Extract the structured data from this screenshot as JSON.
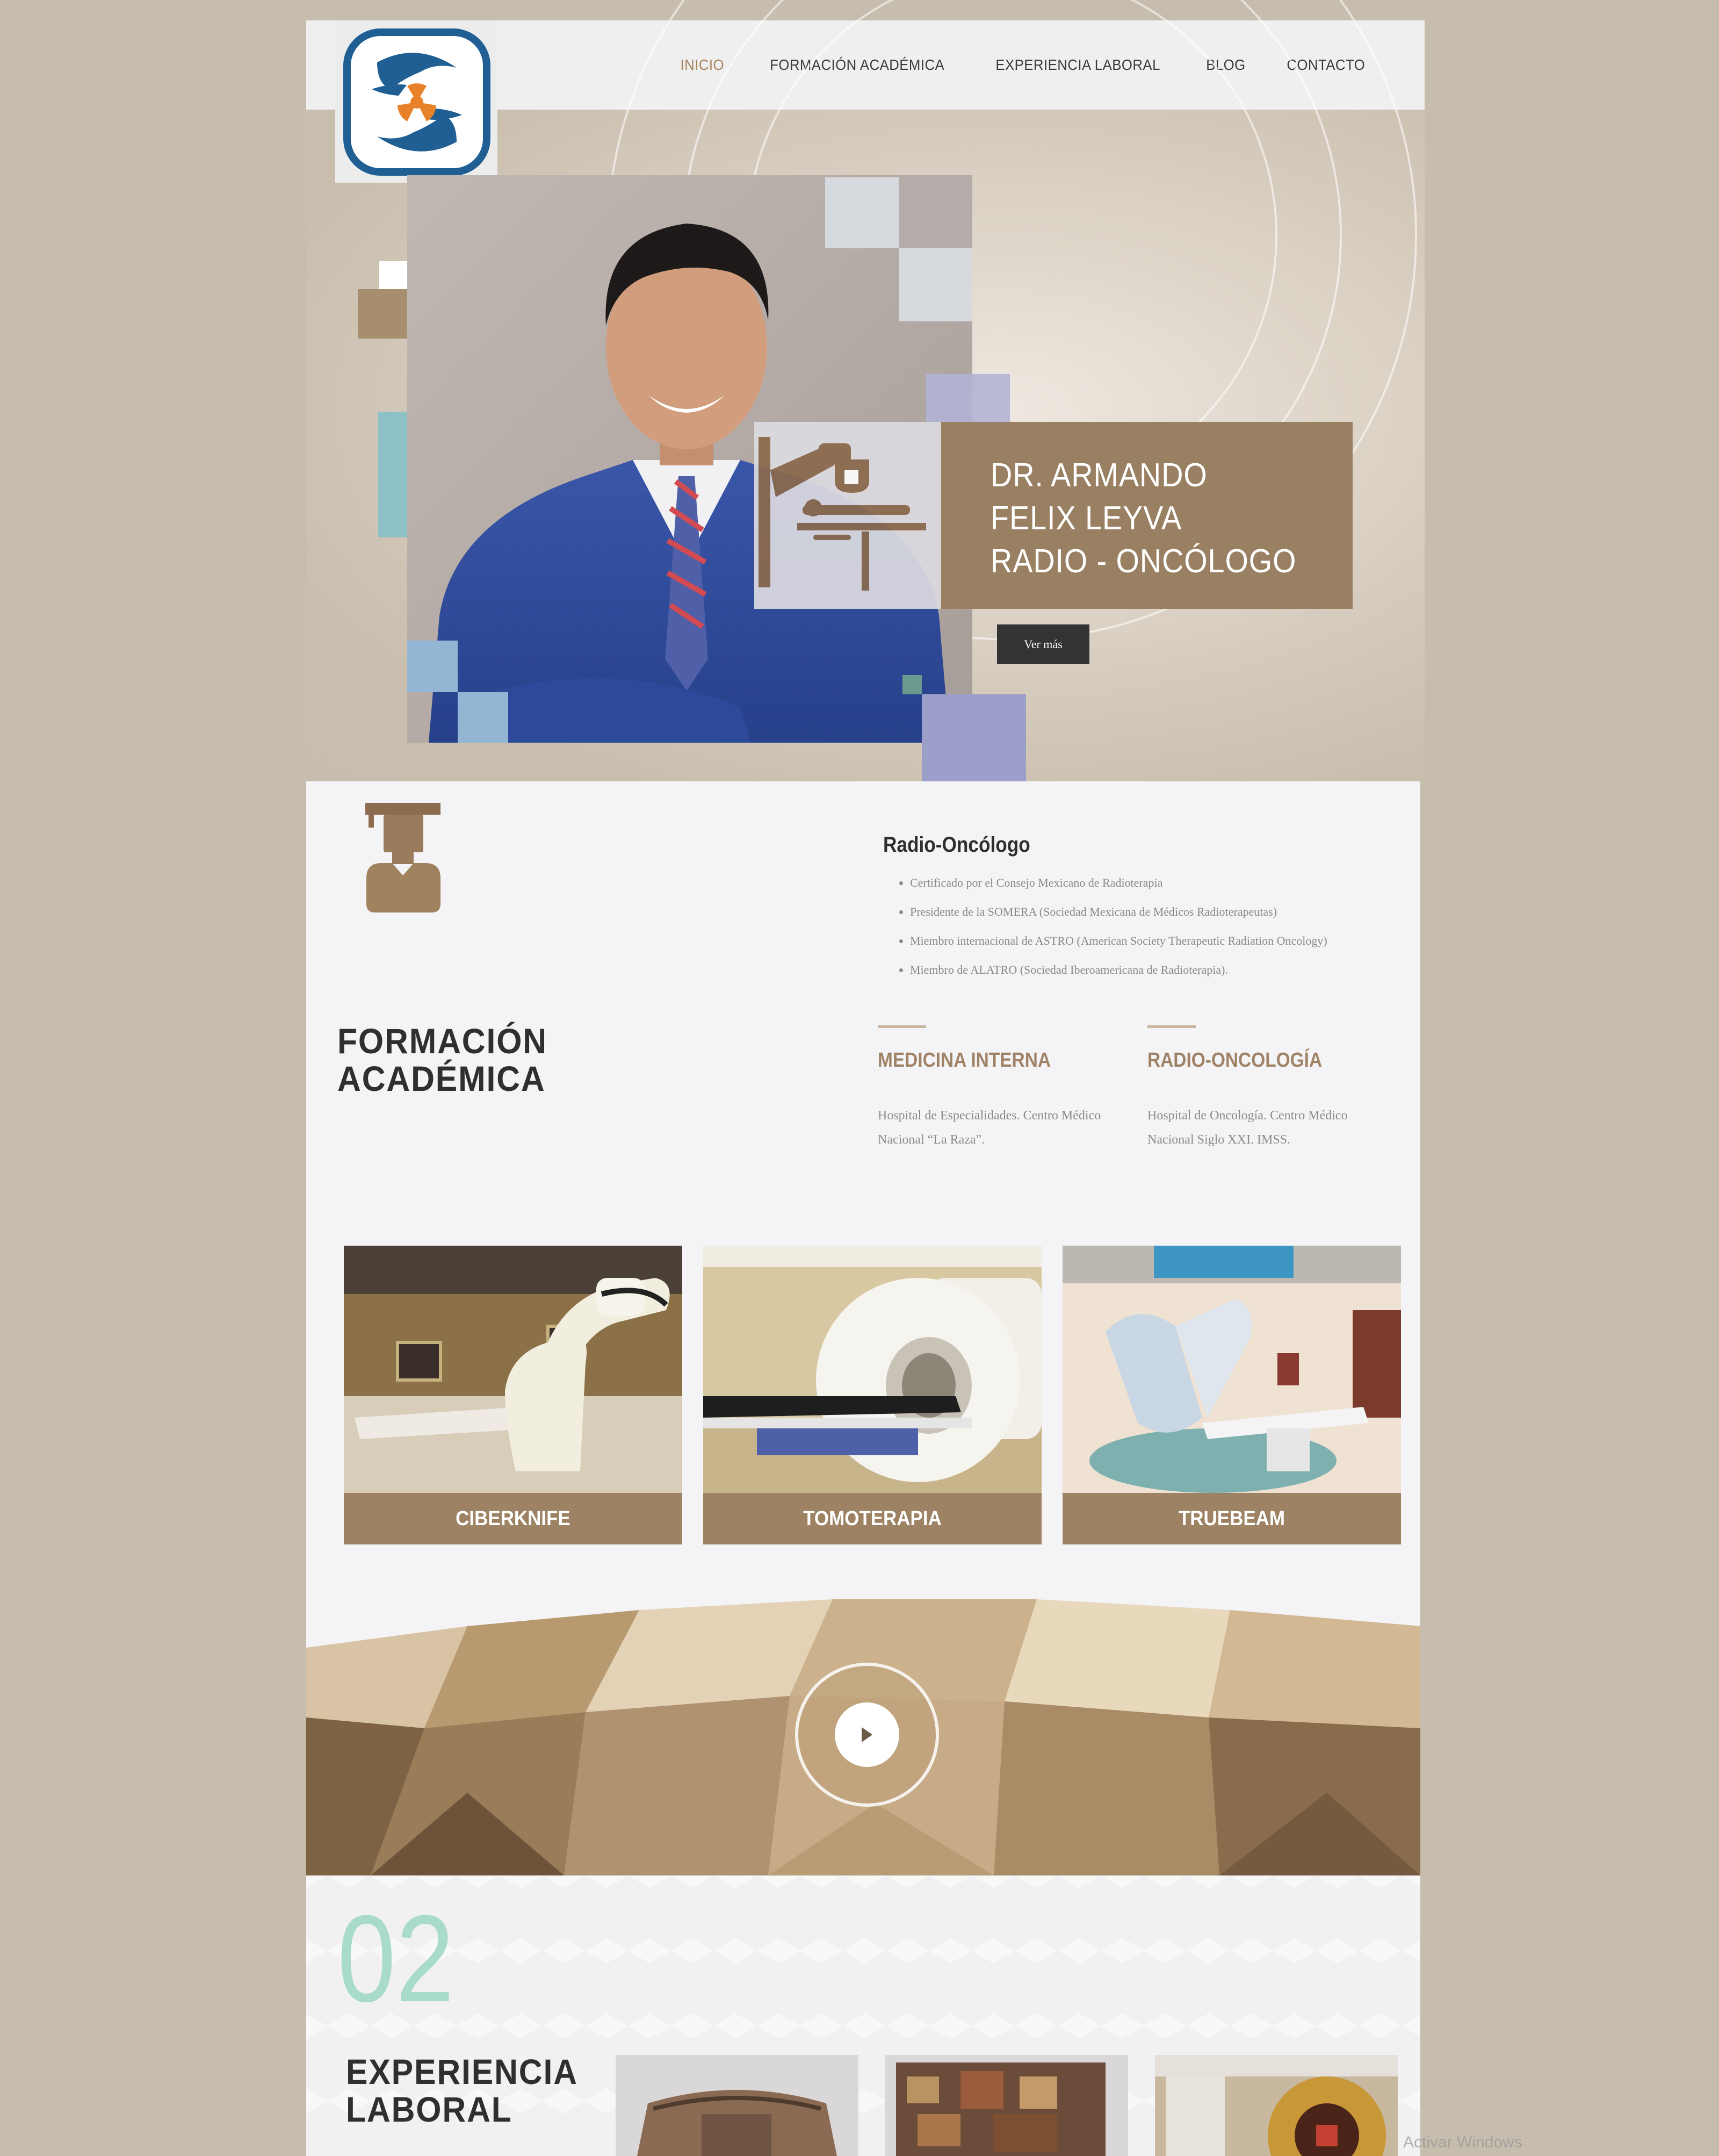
{
  "header": {
    "nav": [
      "INICIO",
      "FORMACIÓN ACADÉMICA",
      "EXPERIENCIA LABORAL",
      "BLOG",
      "CONTACTO"
    ],
    "active": "INICIO"
  },
  "hero": {
    "title_lines": [
      "DR. ARMANDO",
      "FELIX LEYVA",
      "RADIO - ONCÓLOGO"
    ],
    "button": "Ver más"
  },
  "credentials": {
    "heading": "Radio-Oncólogo",
    "items": [
      "Certificado por el Consejo Mexicano de Radioterapia",
      "Presidente de la SOMERA (Sociedad Mexicana de Médicos Radioterapeutas)",
      "Miembro internacional de ASTRO (American Society Therapeutic Radiation  Oncology)",
      "Miembro de ALATRO (Sociedad Iberoamericana de Radioterapia)."
    ]
  },
  "formacion": {
    "title_lines": [
      "FORMACIÓN",
      "ACADÉMICA"
    ],
    "items": [
      {
        "title": "MEDICINA INTERNA",
        "desc": "Hospital de Especialidades. Centro Médico Nacional “La Raza”."
      },
      {
        "title": "RADIO-ONCOLOGÍA",
        "desc": "Hospital de Oncología. Centro Médico Nacional Siglo XXI. IMSS."
      }
    ]
  },
  "equipment": [
    "CIBERKNIFE",
    "TOMOTERAPIA",
    "TRUEBEAM"
  ],
  "experiencia": {
    "number": "02",
    "title_lines": [
      "EXPERIENCIA",
      "LABORAL"
    ]
  },
  "watermark": "Activar Windows",
  "colors": {
    "page_bg": "#c7bdae",
    "accent_brown": "#9d8363",
    "nav_active": "#a8835a",
    "number_mint": "#a9dcc8",
    "logo_blue": "#1f5f94",
    "logo_orange": "#e8822a"
  }
}
